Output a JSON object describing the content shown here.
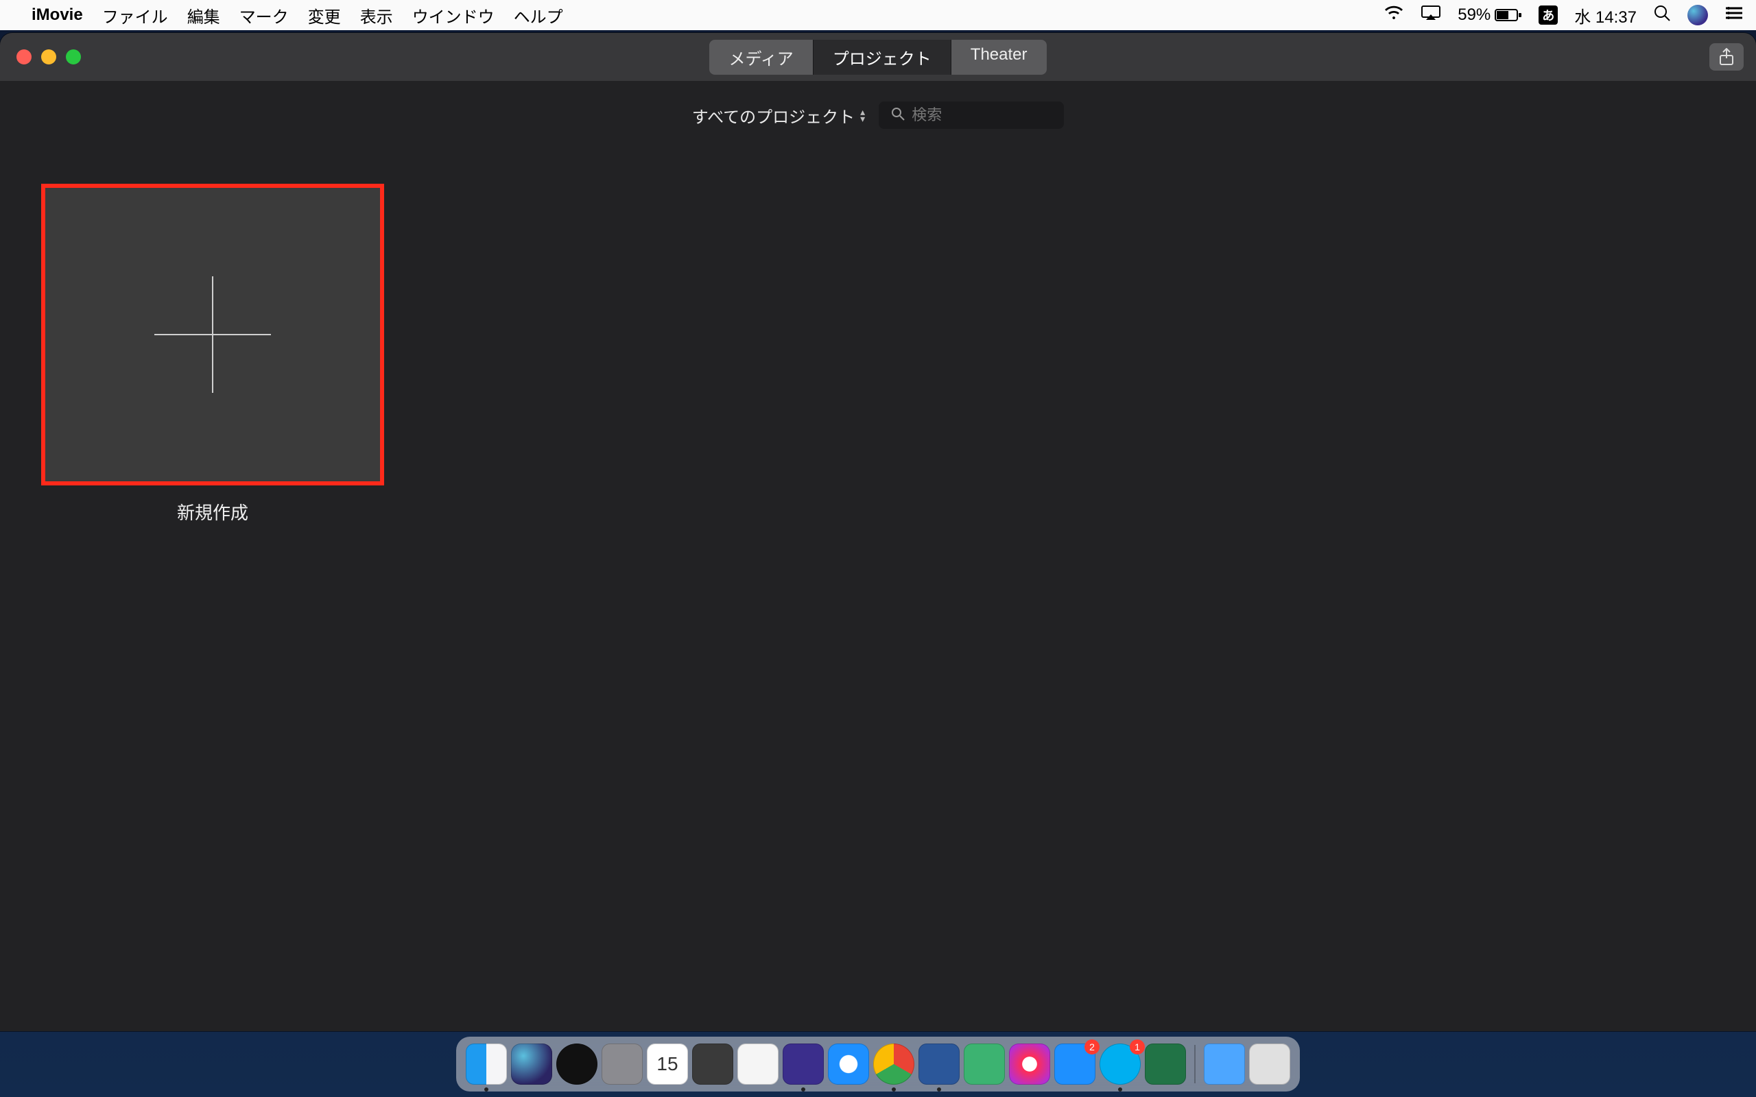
{
  "menubar": {
    "app_name": "iMovie",
    "items": [
      "ファイル",
      "編集",
      "マーク",
      "変更",
      "表示",
      "ウインドウ",
      "ヘルプ"
    ],
    "battery_pct": "59%",
    "ime": "あ",
    "clock": "水 14:37"
  },
  "titlebar": {
    "tabs": [
      {
        "label": "メディア",
        "active": false
      },
      {
        "label": "プロジェクト",
        "active": true
      },
      {
        "label": "Theater",
        "active": false
      }
    ]
  },
  "filter": {
    "label": "すべてのプロジェクト",
    "search_placeholder": "検索"
  },
  "projects": {
    "new_label": "新規作成"
  },
  "dock": {
    "cal_day": "15",
    "appstore_badge": "2",
    "skype_badge": "1"
  }
}
